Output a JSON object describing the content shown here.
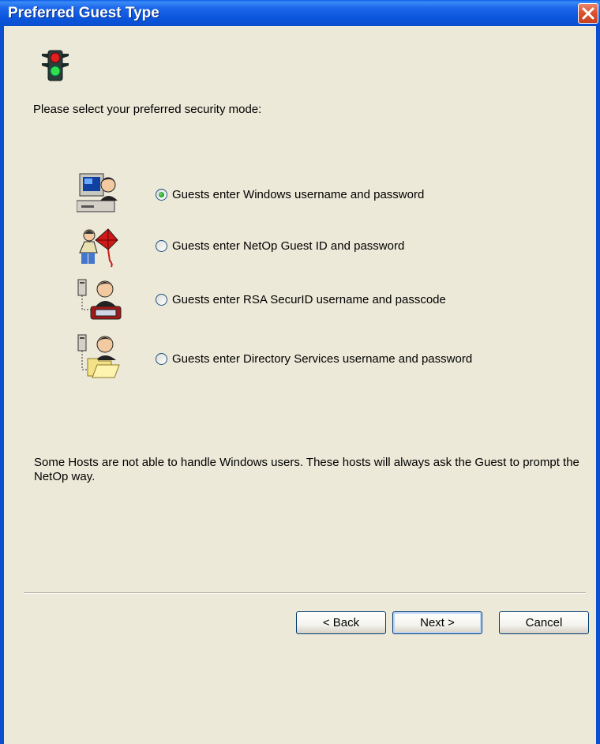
{
  "window": {
    "title": "Preferred Guest Type"
  },
  "prompt": "Please select your preferred security mode:",
  "options": [
    {
      "label": "Guests enter Windows username and password",
      "checked": true,
      "icon": "computer-user-icon"
    },
    {
      "label": "Guests enter NetOp Guest ID and password",
      "checked": false,
      "icon": "netop-guest-icon"
    },
    {
      "label": "Guests enter RSA SecurID username and passcode",
      "checked": false,
      "icon": "rsa-securid-icon"
    },
    {
      "label": "Guests enter Directory Services username and password",
      "checked": false,
      "icon": "directory-services-icon"
    }
  ],
  "note": "Some Hosts are not able to handle Windows users. These hosts will always ask the Guest to prompt the NetOp way.",
  "buttons": {
    "back": "< Back",
    "next": "Next >",
    "cancel": "Cancel"
  },
  "colors": {
    "titlebar": "#0A5CE8",
    "dialog_bg": "#ECE9D8",
    "radio_dot": "#21A121"
  }
}
